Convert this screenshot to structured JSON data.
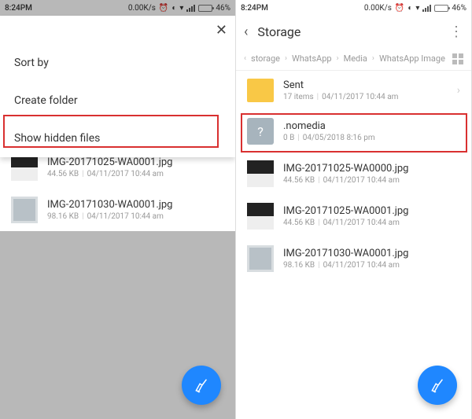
{
  "status": {
    "time": "8:24PM",
    "net_speed": "0.00K/s",
    "battery_pct": "46%"
  },
  "left": {
    "menu": {
      "sort": "Sort by",
      "create": "Create folder",
      "hidden": "Show hidden files"
    },
    "bg_files": [
      {
        "name": "IMG-20171025-WA0001.jpg",
        "size": "44.56 KB",
        "date": "04/11/2017 10:44 am",
        "thumb": "book"
      },
      {
        "name": "IMG-20171030-WA0001.jpg",
        "size": "98.16 KB",
        "date": "04/11/2017 10:44 am",
        "thumb": "grey"
      }
    ]
  },
  "right": {
    "title": "Storage",
    "breadcrumb": [
      "storage",
      "WhatsApp",
      "Media",
      "WhatsApp Image"
    ],
    "rows": [
      {
        "kind": "folder",
        "name": "Sent",
        "sub": "17 items",
        "date": "04/11/2017 10:44 am"
      },
      {
        "kind": "unknown",
        "name": ".nomedia",
        "sub": "0 B",
        "date": "04/05/2018 8:16 pm"
      },
      {
        "kind": "img-book",
        "name": "IMG-20171025-WA0000.jpg",
        "sub": "44.56 KB",
        "date": "04/11/2017 10:44 am"
      },
      {
        "kind": "img-book",
        "name": "IMG-20171025-WA0001.jpg",
        "sub": "44.56 KB",
        "date": "04/11/2017 10:44 am"
      },
      {
        "kind": "img-grey",
        "name": "IMG-20171030-WA0001.jpg",
        "sub": "98.16 KB",
        "date": "04/11/2017 10:44 am"
      }
    ]
  }
}
